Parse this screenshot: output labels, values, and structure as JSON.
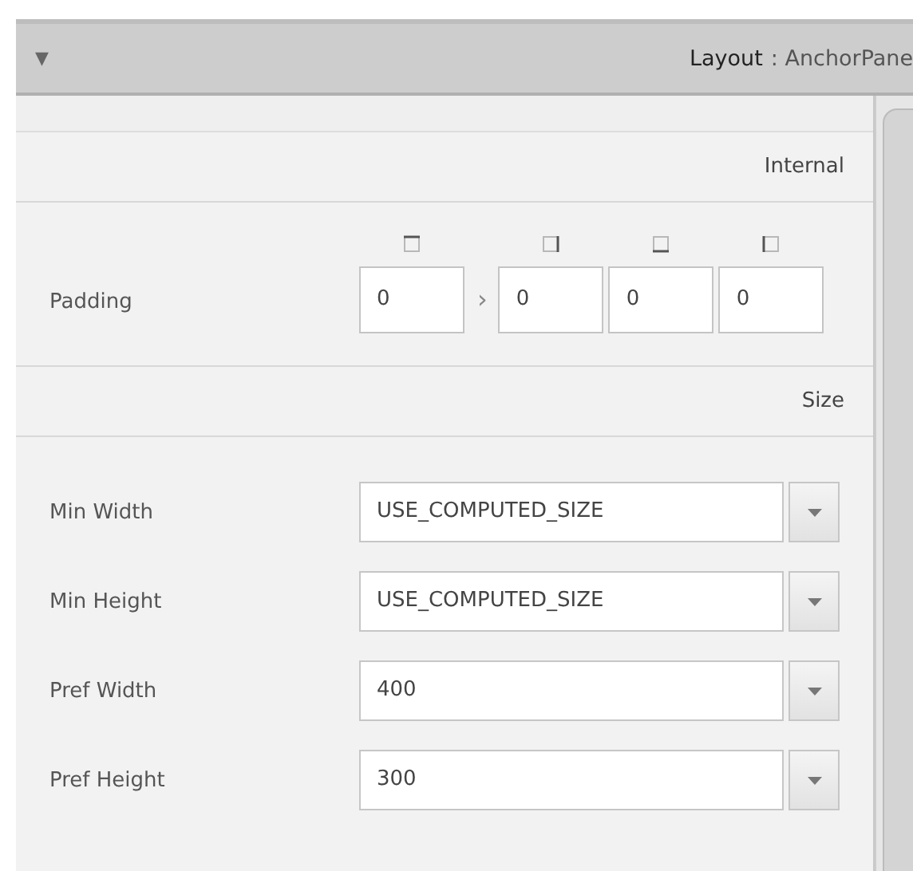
{
  "header": {
    "toggle": "▼",
    "title": "Layout",
    "subtitle": ": AnchorPane"
  },
  "sections": [
    {
      "title": "Internal",
      "rows": [
        {
          "kind": "padding",
          "label": "Padding",
          "link": "›",
          "values": [
            "0",
            "0",
            "0",
            "0"
          ]
        }
      ]
    },
    {
      "title": "Size",
      "rows": [
        {
          "kind": "combo",
          "label": "Min Width",
          "value": "USE_COMPUTED_SIZE"
        },
        {
          "kind": "combo",
          "label": "Min Height",
          "value": "USE_COMPUTED_SIZE"
        },
        {
          "kind": "combo",
          "label": "Pref Width",
          "value": "400"
        },
        {
          "kind": "combo",
          "label": "Pref Height",
          "value": "300"
        }
      ]
    }
  ]
}
